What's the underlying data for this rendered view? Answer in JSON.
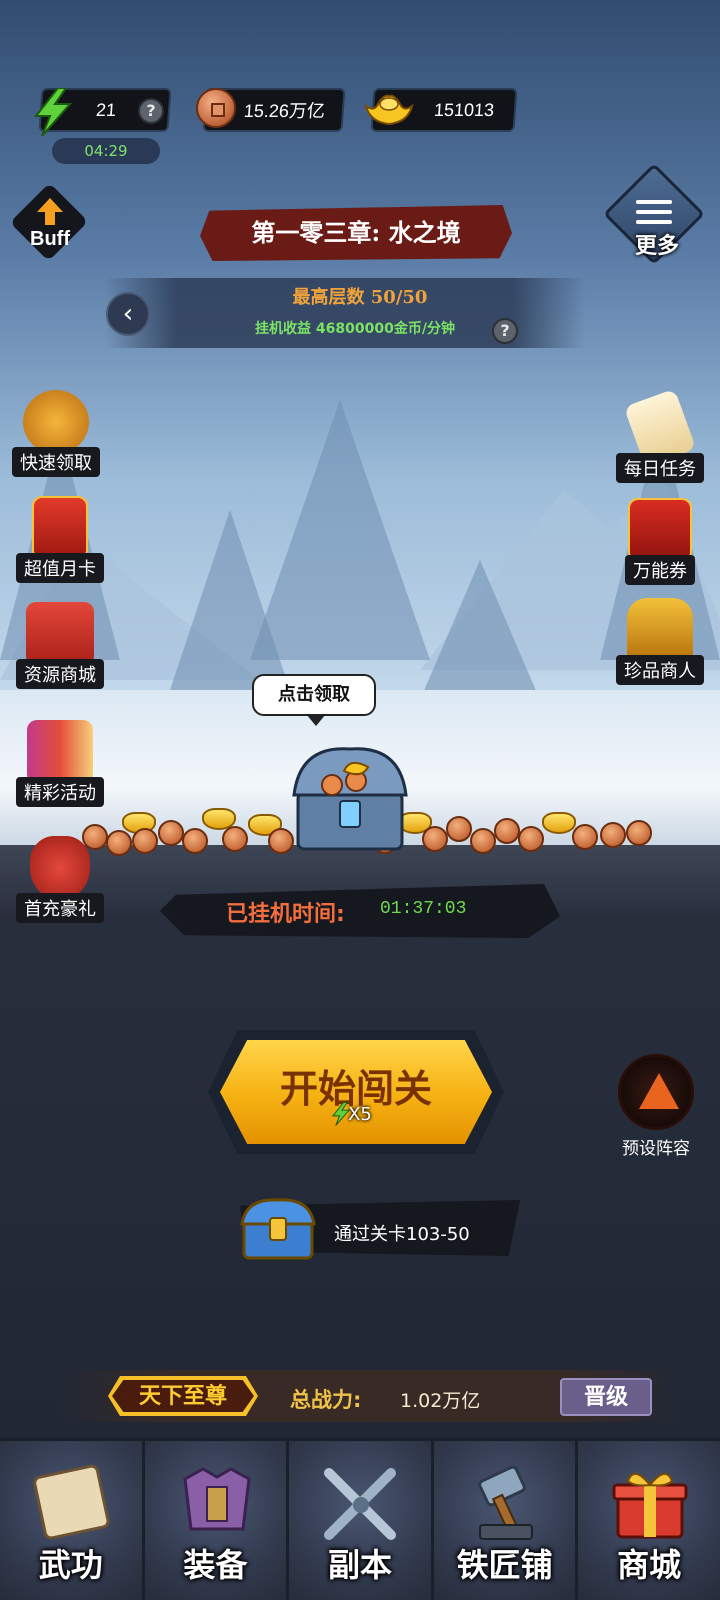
{
  "resources": {
    "energy": "21",
    "coins": "15.26万亿",
    "ingots": "151013",
    "energy_timer": "04:29",
    "help": "?"
  },
  "buff_label": "Buff",
  "more_label": "更多",
  "chapter": {
    "title": "第一零三章: 水之境",
    "max_floor": "最高层数 50/50",
    "idle_income": "挂机收益 46800000金币/分钟",
    "back": "‹"
  },
  "left_menu": [
    {
      "label": "快速领取",
      "icon": "crown-arrow-icon"
    },
    {
      "label": "超值月卡",
      "icon": "month-card-icon"
    },
    {
      "label": "资源商城",
      "icon": "gift-box-icon"
    },
    {
      "label": "精彩活动",
      "icon": "event-books-icon"
    },
    {
      "label": "首充豪礼",
      "icon": "money-bag-icon"
    }
  ],
  "right_menu": [
    {
      "label": "每日任务",
      "icon": "scroll-icon"
    },
    {
      "label": "万能券",
      "icon": "ticket-icon"
    },
    {
      "label": "珍品商人",
      "icon": "treasure-chest-icon"
    }
  ],
  "tap_tip": "点击领取",
  "idle_time": {
    "label": "已挂机时间:",
    "value": "01:37:03"
  },
  "start": {
    "label": "开始闯关",
    "cost": "X5"
  },
  "preset_label": "预设阵容",
  "stage_reward": "通过关卡103-50",
  "power": {
    "rank": "天下至尊",
    "label": "总战力:",
    "value": "1.02万亿",
    "upgrade": "晋级"
  },
  "nav": [
    {
      "label": "武功",
      "icon": "martial-scroll-icon"
    },
    {
      "label": "装备",
      "icon": "armor-icon"
    },
    {
      "label": "副本",
      "icon": "crossed-swords-icon"
    },
    {
      "label": "铁匠铺",
      "icon": "hammer-icon"
    },
    {
      "label": "商城",
      "icon": "shop-gift-icon"
    }
  ],
  "colors": {
    "accent_gold": "#f6b112",
    "banner_red": "#6b1b16",
    "green_text": "#7be364",
    "orange_title": "#f0a33a"
  }
}
